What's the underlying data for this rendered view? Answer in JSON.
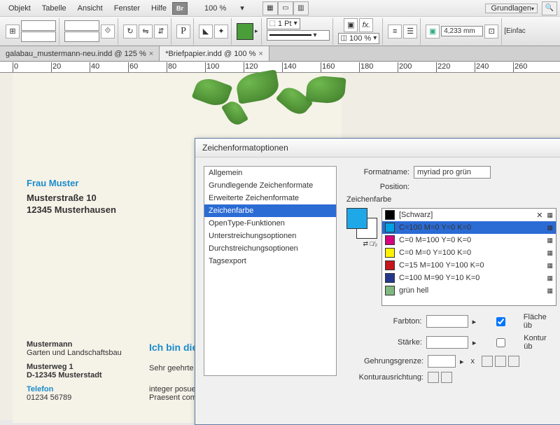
{
  "menu": {
    "items": [
      "Objekt",
      "Tabelle",
      "Ansicht",
      "Fenster",
      "Hilfe"
    ],
    "zoom": "100 %",
    "workspace": "Grundlagen"
  },
  "toolbar": {
    "stroke_weight": "1 Pt",
    "stroke_pct": "100 %",
    "measure": "4,233 mm",
    "einfac": "[Einfac"
  },
  "tabs": [
    {
      "label": "galabau_mustermann-neu.indd @ 125 %",
      "active": false
    },
    {
      "label": "*Briefpapier.indd @ 100 %",
      "active": true
    }
  ],
  "ruler_marks": [
    0,
    20,
    40,
    60,
    80,
    100,
    120,
    140,
    160,
    180,
    200,
    220,
    240,
    260
  ],
  "doc": {
    "addr_name": "Frau Muster",
    "addr_street": "Musterstraße 10",
    "addr_city": "12345 Musterhausen",
    "foot_name": "Mustermann",
    "foot_sub": "Garten und Landschaftsbau",
    "foot_street": "Musterweg 1",
    "foot_city": "D-12345 Musterstadt",
    "foot_tel_lbl": "Telefon",
    "foot_tel": "01234 56789",
    "body_head": "Ich bin die H",
    "body_line1": "Sehr geehrte F",
    "body_line2": "integer posue",
    "body_line3": "Praesent comr"
  },
  "dialog": {
    "title": "Zeichenformatoptionen",
    "categories": [
      "Allgemein",
      "Grundlegende Zeichenformate",
      "Erweiterte Zeichenformate",
      "Zeichenfarbe",
      "OpenType-Funktionen",
      "Unterstreichungsoptionen",
      "Durchstreichungsoptionen",
      "Tagsexport"
    ],
    "sel_cat": 3,
    "formatname_lbl": "Formatname:",
    "formatname": "myriad pro grün",
    "position_lbl": "Position:",
    "section": "Zeichenfarbe",
    "colors": [
      {
        "name": "[Schwarz]",
        "hex": "#000000",
        "reg": true
      },
      {
        "name": "C=100 M=0 Y=0 K=0",
        "hex": "#00a0e3",
        "sel": true
      },
      {
        "name": "C=0 M=100 Y=0 K=0",
        "hex": "#d6007e"
      },
      {
        "name": "C=0 M=0 Y=100 K=0",
        "hex": "#fff200"
      },
      {
        "name": "C=15 M=100 Y=100 K=0",
        "hex": "#c4161c"
      },
      {
        "name": "C=100 M=90 Y=10 K=0",
        "hex": "#23378c"
      },
      {
        "name": "grün hell",
        "hex": "#7fb77e"
      }
    ],
    "farbton": "Farbton:",
    "staerke": "Stärke:",
    "gehrung": "Gehrungsgrenze:",
    "kontur": "Konturausrichtung:",
    "flaeche": "Fläche üb",
    "konturub": "Kontur üb",
    "x": "x"
  }
}
